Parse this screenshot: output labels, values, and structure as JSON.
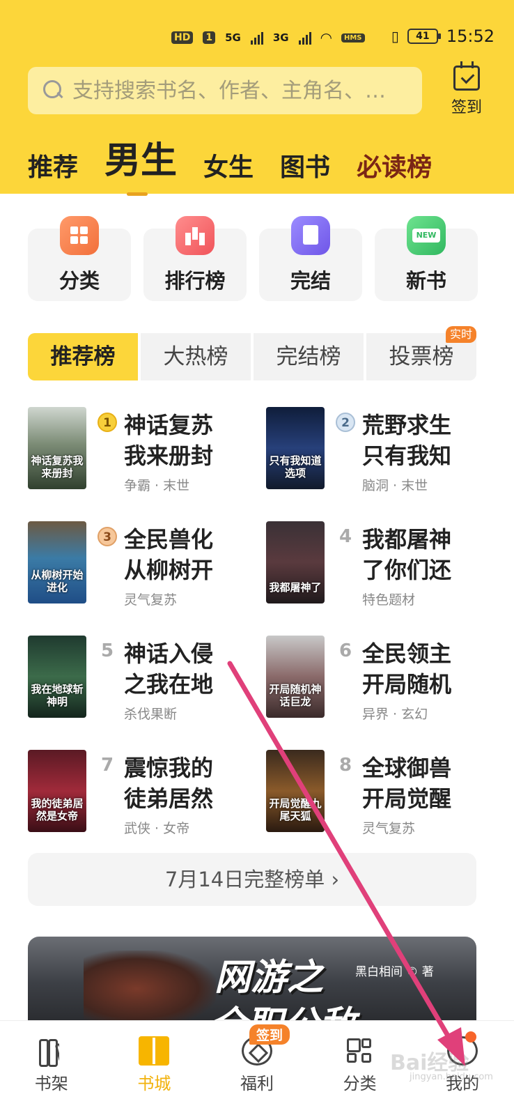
{
  "status": {
    "network": "HD",
    "sim": "1",
    "sig1": "5G",
    "sig2": "3G",
    "hms": "HMS",
    "battery": "41",
    "time": "15:52"
  },
  "search": {
    "placeholder": "支持搜索书名、作者、主角名、…"
  },
  "checkin": {
    "label": "签到"
  },
  "top_tabs": [
    "推荐",
    "男生",
    "女生",
    "图书",
    "必读榜"
  ],
  "categories": [
    {
      "label": "分类",
      "icon": "category-icon",
      "color": "#f47a43"
    },
    {
      "label": "排行榜",
      "icon": "ranking-icon",
      "color": "#f2585d"
    },
    {
      "label": "完结",
      "icon": "completed-icon",
      "color": "#7560ea"
    },
    {
      "label": "新书",
      "icon": "new-book-icon",
      "color": "#35bb63"
    }
  ],
  "rank_tabs": [
    "推荐榜",
    "大热榜",
    "完结榜",
    "投票榜"
  ],
  "rank_tab_badge": "实时",
  "books": [
    {
      "rank": "1",
      "title": "神话复苏我来册封",
      "tag": "争霸 · 末世",
      "cover_text": "神话复苏我来册封"
    },
    {
      "rank": "2",
      "title": "荒野求生只有我知",
      "tag": "脑洞 · 末世",
      "cover_text": "只有我知道选项"
    },
    {
      "rank": "3",
      "title": "全民兽化从柳树开",
      "tag": "灵气复苏",
      "cover_text": "从柳树开始进化"
    },
    {
      "rank": "4",
      "title": "我都屠神了你们还",
      "tag": "特色题材",
      "cover_text": "我都屠神了"
    },
    {
      "rank": "5",
      "title": "神话入侵之我在地",
      "tag": "杀伐果断",
      "cover_text": "我在地球斩神明"
    },
    {
      "rank": "6",
      "title": "全民领主开局随机",
      "tag": "异界 · 玄幻",
      "cover_text": "开局随机神话巨龙"
    },
    {
      "rank": "7",
      "title": "震惊我的徒弟居然",
      "tag": "武侠 · 女帝",
      "cover_text": "我的徒弟居然是女帝"
    },
    {
      "rank": "8",
      "title": "全球御兽开局觉醒",
      "tag": "灵气复苏",
      "cover_text": "开局觉醒九尾天狐"
    }
  ],
  "full_list": {
    "label": "7月14日完整榜单 ›"
  },
  "banner": {
    "title_line1": "网游之",
    "title_line2": "全职公敌",
    "author": "黑白相间 © 著"
  },
  "bottom_nav": [
    {
      "label": "书架",
      "icon": "bookshelf-icon"
    },
    {
      "label": "书城",
      "icon": "bookstore-icon"
    },
    {
      "label": "福利",
      "icon": "benefits-icon"
    },
    {
      "label": "分类",
      "icon": "category-grid-icon"
    },
    {
      "label": "我的",
      "icon": "profile-icon"
    }
  ],
  "bottom_badge": "签到",
  "watermark": {
    "brand": "Bai经验",
    "url": "jingyan.baidu.com"
  },
  "colors": {
    "header_yellow": "#fcd63a",
    "accent_orange": "#f5822a",
    "annotation_arrow": "#e0407a",
    "active_nav": "#f2b20c"
  }
}
